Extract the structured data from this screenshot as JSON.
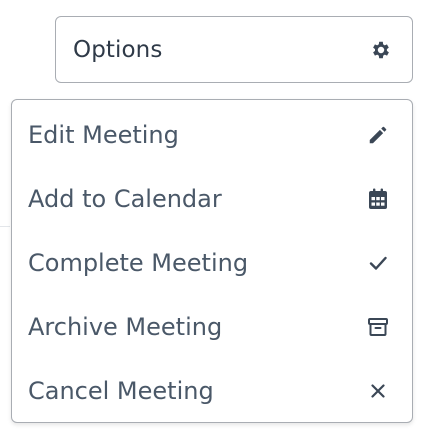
{
  "button": {
    "label": "Options",
    "icon": "gear-icon"
  },
  "menu": {
    "items": [
      {
        "label": "Edit Meeting",
        "icon": "pencil-icon"
      },
      {
        "label": "Add to Calendar",
        "icon": "calendar-icon"
      },
      {
        "label": "Complete Meeting",
        "icon": "checkmark-icon"
      },
      {
        "label": "Archive Meeting",
        "icon": "archive-box-icon"
      },
      {
        "label": "Cancel Meeting",
        "icon": "close-icon"
      }
    ]
  },
  "colors": {
    "text_primary": "#2f3a48",
    "text_menu": "#4a5868",
    "icon": "#3b4756",
    "border": "#a9adb3",
    "background": "#ffffff"
  }
}
